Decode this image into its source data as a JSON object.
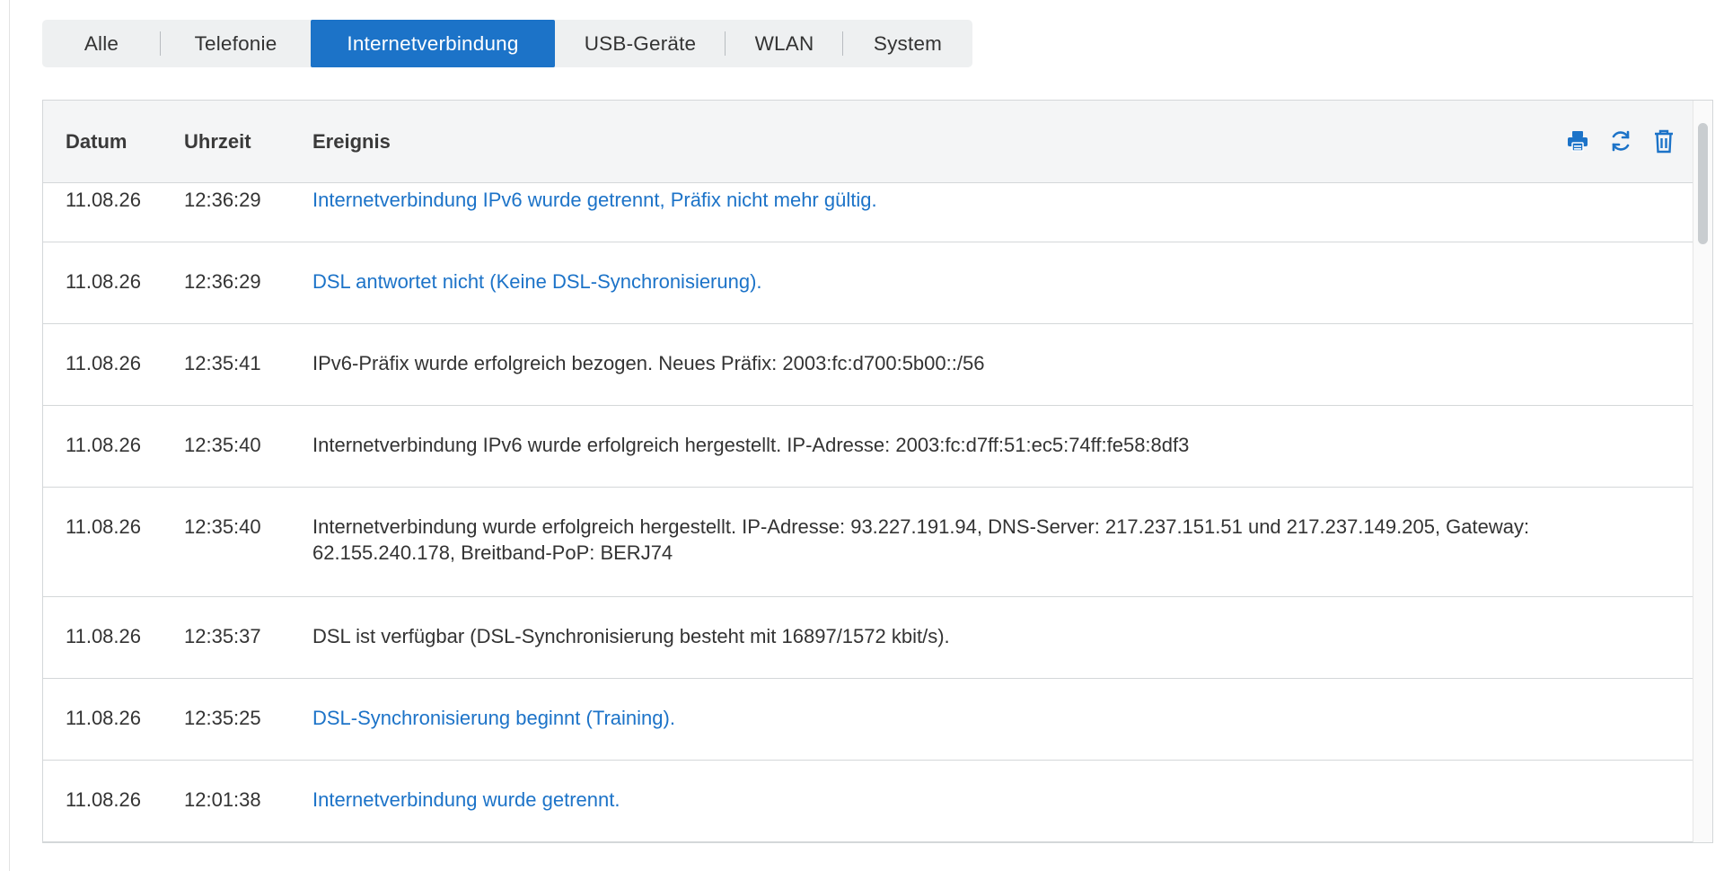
{
  "tabs": [
    {
      "label": "Alle",
      "active": false
    },
    {
      "label": "Telefonie",
      "active": false
    },
    {
      "label": "Internetverbindung",
      "active": true
    },
    {
      "label": "USB-Geräte",
      "active": false
    },
    {
      "label": "WLAN",
      "active": false
    },
    {
      "label": "System",
      "active": false
    }
  ],
  "table": {
    "headers": {
      "datum": "Datum",
      "uhrzeit": "Uhrzeit",
      "ereignis": "Ereignis"
    },
    "actions": [
      {
        "name": "print-icon",
        "color": "#1c73c8"
      },
      {
        "name": "refresh-icon",
        "color": "#1c73c8"
      },
      {
        "name": "trash-icon",
        "color": "#1c73c8"
      }
    ],
    "rows": [
      {
        "datum": "11.08.26",
        "uhrzeit": "12:36:29",
        "ereignis": "Internetverbindung IPv6 wurde getrennt, Präfix nicht mehr gültig.",
        "link": true
      },
      {
        "datum": "11.08.26",
        "uhrzeit": "12:36:29",
        "ereignis": "DSL antwortet nicht (Keine DSL-Synchronisierung).",
        "link": true
      },
      {
        "datum": "11.08.26",
        "uhrzeit": "12:35:41",
        "ereignis": "IPv6-Präfix wurde erfolgreich bezogen. Neues Präfix: 2003:fc:d700:5b00::/56",
        "link": false
      },
      {
        "datum": "11.08.26",
        "uhrzeit": "12:35:40",
        "ereignis": "Internetverbindung IPv6 wurde erfolgreich hergestellt. IP-Adresse: 2003:fc:d7ff:51:ec5:74ff:fe58:8df3",
        "link": false
      },
      {
        "datum": "11.08.26",
        "uhrzeit": "12:35:40",
        "ereignis": "Internetverbindung wurde erfolgreich hergestellt. IP-Adresse: 93.227.191.94, DNS-Server: 217.237.151.51 und 217.237.149.205, Gateway: 62.155.240.178, Breitband-PoP: BERJ74",
        "link": false
      },
      {
        "datum": "11.08.26",
        "uhrzeit": "12:35:37",
        "ereignis": "DSL ist verfügbar (DSL-Synchronisierung besteht mit 16897/1572 kbit/s).",
        "link": false
      },
      {
        "datum": "11.08.26",
        "uhrzeit": "12:35:25",
        "ereignis": "DSL-Synchronisierung beginnt (Training).",
        "link": true
      },
      {
        "datum": "11.08.26",
        "uhrzeit": "12:01:38",
        "ereignis": "Internetverbindung wurde getrennt.",
        "link": true
      }
    ]
  }
}
